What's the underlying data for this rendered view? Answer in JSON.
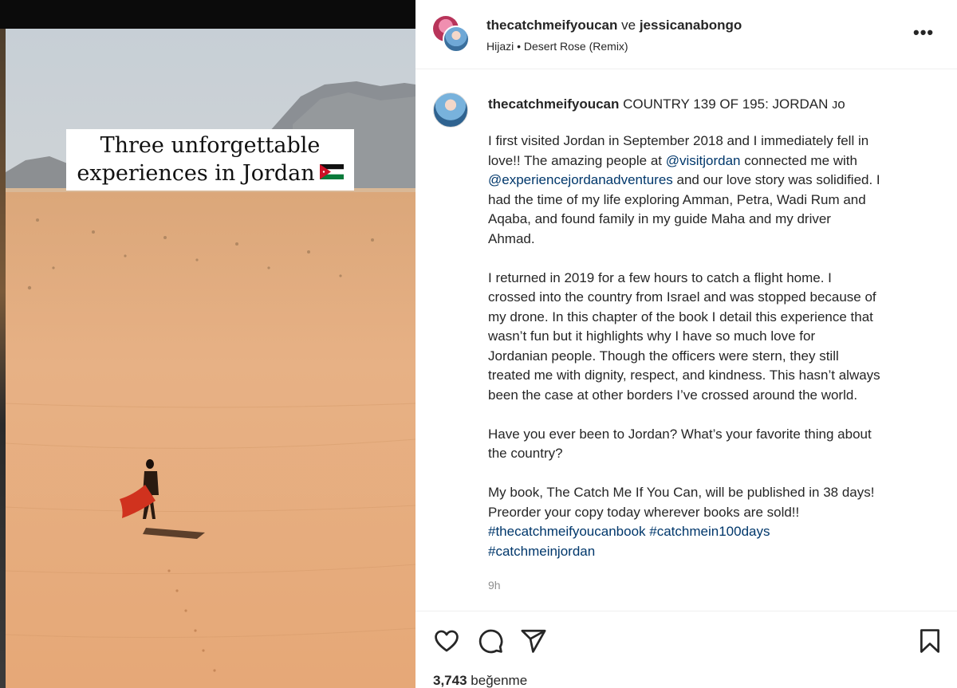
{
  "media": {
    "overlay_line1": "Three unforgettable",
    "overlay_line2": "experiences in Jordan",
    "flag_icon": "jordan-flag-emoji"
  },
  "header": {
    "user1": "thecatchmeifyoucan",
    "conjunction": "ve",
    "user2": "jessicanabongo",
    "audio": "Hijazi • Desert Rose (Remix)",
    "more_icon": "more-horizontal-icon",
    "more_label": "•••"
  },
  "caption": {
    "username": "thecatchmeifyoucan",
    "headline": "COUNTRY 139 OF 195: JORDAN 🇯🇴",
    "headline_display": "COUNTRY 139 OF 195: JORDAN ᴊᴏ",
    "p1": {
      "l1": "I first visited Jordan in September 2018 and I immediately fell in",
      "l2_pre": "love!! The amazing people at ",
      "l2_link": "@visitjordan",
      "l2_post": " connected me with",
      "l3_link": "@experiencejordanadventures",
      "l3_post": " and our love story was solidified. I",
      "l4": "had the time of my life exploring Amman, Petra, Wadi Rum and",
      "l5": "Aqaba, and found family in my guide Maha and my driver",
      "l6": "Ahmad."
    },
    "p2": [
      "I returned in 2019 for a few hours to catch a flight home. I",
      "crossed into the country from Israel and was stopped because of",
      "my drone. In this chapter of the book I detail this experience that",
      "wasn’t fun but it highlights why I have so much love for",
      "Jordanian people. Though the officers were stern, they still",
      "treated me with dignity, respect, and kindness. This hasn’t always",
      "been the case at other borders I’ve crossed around the world."
    ],
    "p3": [
      "Have you ever been to Jordan? What’s your favorite thing about",
      "the country?"
    ],
    "p4": [
      "My book, The Catch Me If You Can, will be published in 38 days!",
      "Preorder your copy today wherever books are sold!!"
    ],
    "hashtags_line1_a": "#thecatchmeifyoucanbook",
    "hashtags_line1_b": "#catchmein100days",
    "hashtags_line2": "#catchmeinjordan",
    "time": "9h"
  },
  "actions": {
    "like_icon": "heart-icon",
    "comment_icon": "comment-icon",
    "share_icon": "share-icon",
    "save_icon": "bookmark-icon",
    "likes_count": "3,743",
    "likes_word": "beğenme"
  },
  "colors": {
    "link": "#00376b",
    "text": "#262626",
    "muted": "#8e8e8e",
    "divider": "#efefef"
  }
}
